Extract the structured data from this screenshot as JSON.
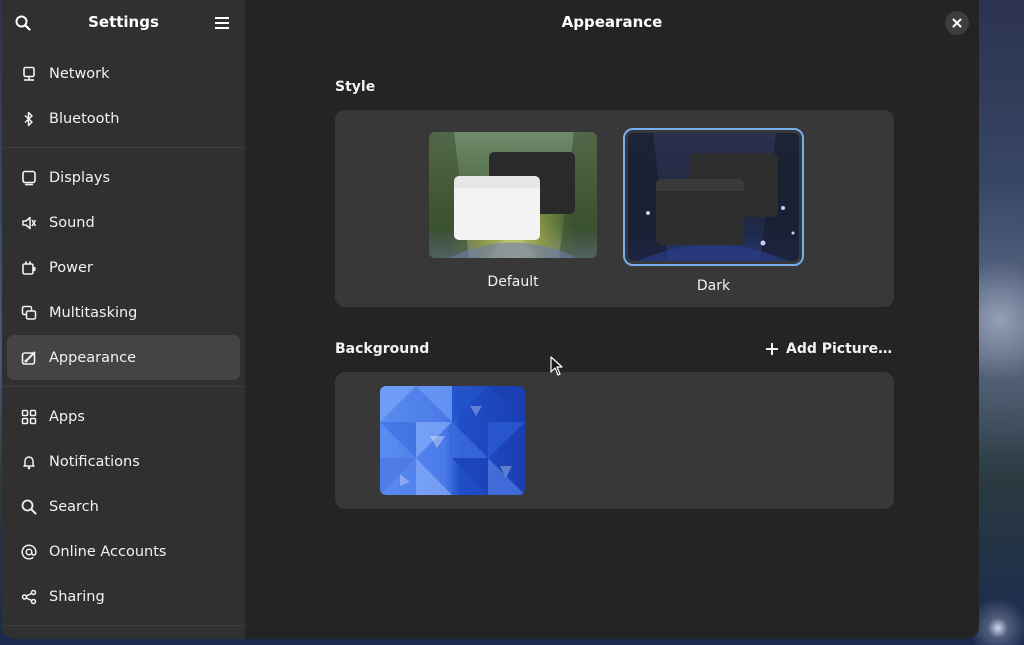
{
  "sidebar": {
    "title": "Settings",
    "groups": [
      [
        {
          "label": "Network",
          "icon": "network-icon"
        },
        {
          "label": "Bluetooth",
          "icon": "bluetooth-icon"
        }
      ],
      [
        {
          "label": "Displays",
          "icon": "display-icon"
        },
        {
          "label": "Sound",
          "icon": "sound-icon"
        },
        {
          "label": "Power",
          "icon": "power-icon"
        },
        {
          "label": "Multitasking",
          "icon": "multitasking-icon"
        },
        {
          "label": "Appearance",
          "icon": "appearance-icon",
          "active": true
        }
      ],
      [
        {
          "label": "Apps",
          "icon": "apps-icon"
        },
        {
          "label": "Notifications",
          "icon": "bell-icon"
        },
        {
          "label": "Search",
          "icon": "search-icon"
        },
        {
          "label": "Online Accounts",
          "icon": "at-icon"
        },
        {
          "label": "Sharing",
          "icon": "share-icon"
        }
      ]
    ]
  },
  "content": {
    "title": "Appearance",
    "style_label": "Style",
    "styles": [
      {
        "label": "Default",
        "selected": false
      },
      {
        "label": "Dark",
        "selected": true
      }
    ],
    "background_label": "Background",
    "add_picture_label": "Add Picture…"
  },
  "colors": {
    "accent": "#78aeed",
    "window_bg": "#242424",
    "sidebar_bg": "#303030",
    "card_bg": "#383838"
  }
}
